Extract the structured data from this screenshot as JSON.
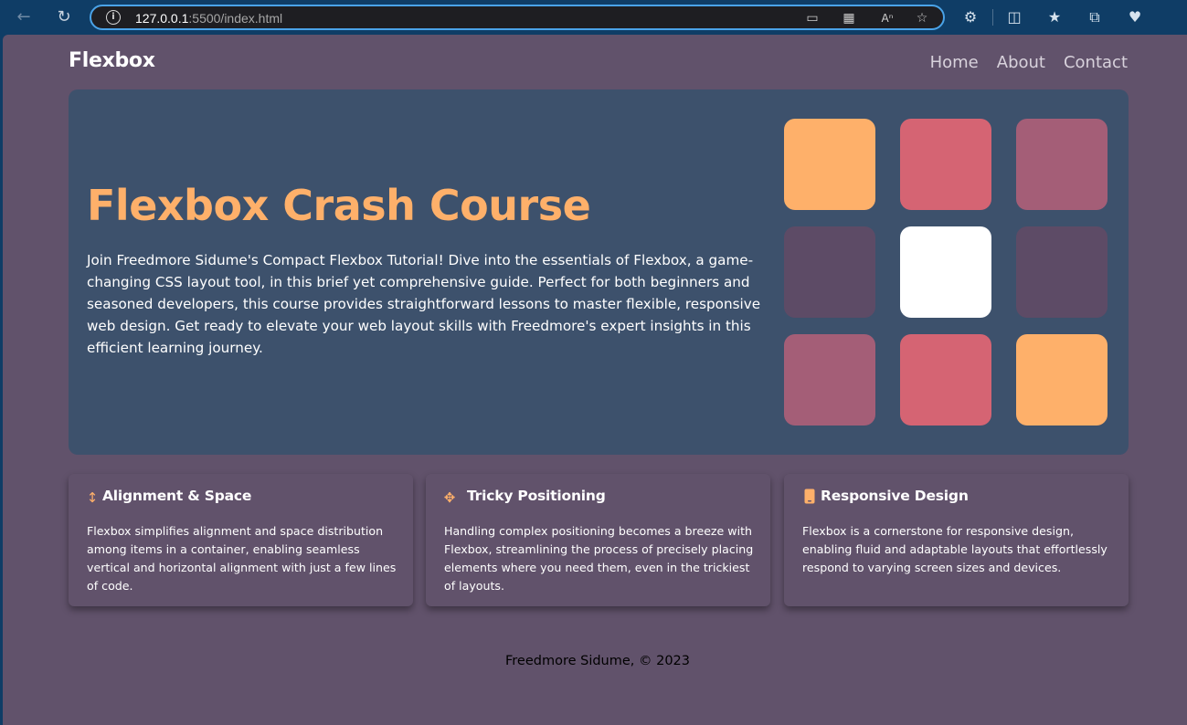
{
  "browser": {
    "url_host": "127.0.0.1",
    "url_path": ":5500/index.html"
  },
  "navbar": {
    "brand": "Flexbox",
    "links": [
      "Home",
      "About",
      "Contact"
    ]
  },
  "hero": {
    "title": "Flexbox Crash Course",
    "description": "Join Freedmore Sidume's Compact Flexbox Tutorial! Dive into the essentials of Flexbox, a game-changing CSS layout tool, in this brief yet comprehensive guide. Perfect for both beginners and seasoned developers, this course provides straightforward lessons to master flexible, responsive web design. Get ready to elevate your web layout skills with Freedmore's expert insights in this efficient learning journey.",
    "tile_colors": [
      "#feb06a",
      "#d56473",
      "#a45e77",
      "#5d4b66",
      "#ffffff",
      "#5d4b66",
      "#a45e77",
      "#d56473",
      "#feb06a"
    ]
  },
  "features": [
    {
      "icon": "arrows-vertical-icon",
      "title": "Alignment & Space",
      "text": "Flexbox simplifies alignment and space distribution among items in a container, enabling seamless vertical and horizontal alignment with just a few lines of code."
    },
    {
      "icon": "arrows-move-icon",
      "title": "Tricky Positioning",
      "text": "Handling complex positioning becomes a breeze with Flexbox, streamlining the process of precisely placing elements where you need them, even in the trickiest of layouts."
    },
    {
      "icon": "mobile-phone-icon",
      "title": "Responsive Design",
      "text": "Flexbox is a cornerstone for responsive design, enabling fluid and adaptable layouts that effortlessly respond to varying screen sizes and devices."
    }
  ],
  "footer": {
    "text": "Freedmore Sidume, © 2023"
  },
  "colors": {
    "page_bg": "#61526b",
    "hero_bg": "#3d516c",
    "accent": "#feb06a"
  }
}
